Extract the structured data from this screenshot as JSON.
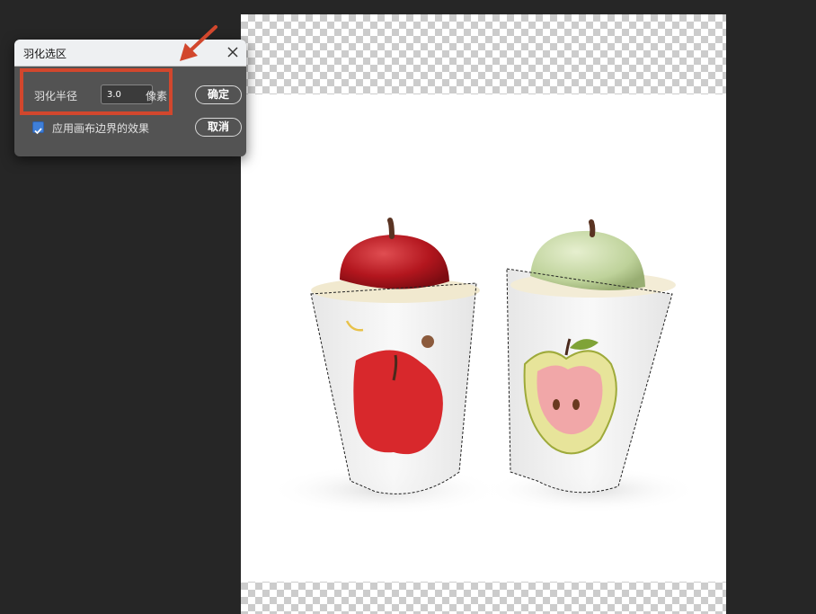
{
  "dialog": {
    "title": "羽化选区",
    "radius_label": "羽化半径",
    "radius_value": "3.0",
    "unit": "像素",
    "ok_label": "确定",
    "cancel_label": "取消",
    "apply_canvas_label": "应用画布边界的效果",
    "apply_canvas_checked": true
  },
  "colors": {
    "annotation": "#d2472d",
    "checkbox": "#3f7fd8"
  }
}
